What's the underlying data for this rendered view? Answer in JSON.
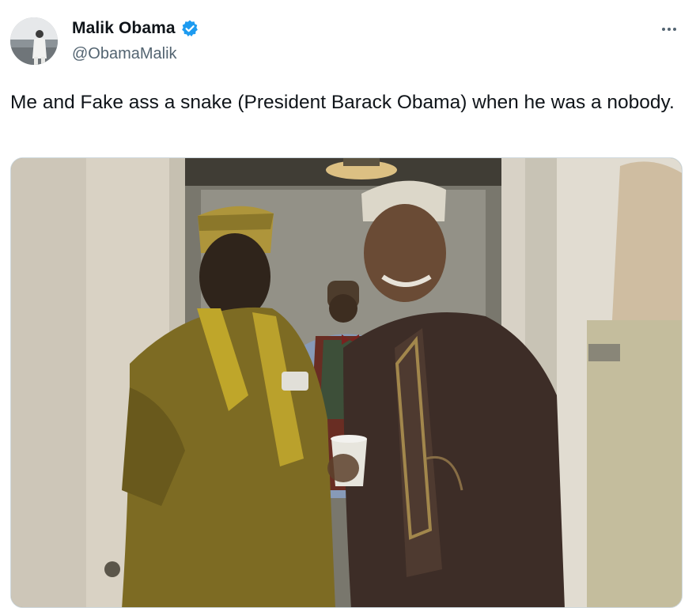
{
  "author": {
    "name": "Malik Obama",
    "handle": "@ObamaMalik",
    "verified": true,
    "avatar_icon": "avatar-photo"
  },
  "tweet": {
    "text": "Me and Fake ass a snake (President Barack Obama) when he was a nobody."
  },
  "media": {
    "type": "photo"
  },
  "icons": {
    "verified": "verified-badge-icon",
    "more": "more-options-icon"
  },
  "colors": {
    "verified_blue": "#1d9bf0",
    "text_primary": "#0f1419",
    "text_secondary": "#536471"
  }
}
